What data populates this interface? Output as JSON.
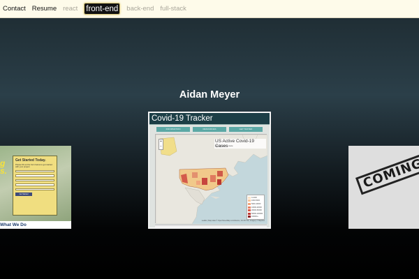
{
  "nav": {
    "items": [
      {
        "label": "Contact"
      },
      {
        "label": "Resume"
      },
      {
        "label": "react"
      },
      {
        "label": "front-end"
      },
      {
        "label": "back-end"
      },
      {
        "label": "full-stack"
      }
    ],
    "active": "front-end"
  },
  "hero": {
    "name": "Aidan Meyer"
  },
  "cards": {
    "center": {
      "title": "Covid-19 Tracker",
      "tabs": [
        "INFORMATION",
        "RESOURCES",
        "GET TESTED"
      ],
      "map_title": "US Active Covid-19 Cases",
      "map_subtitle": "Hover over a state",
      "legend": [
        "0-1000",
        "1000-5000",
        "5000-10000",
        "10000-20000",
        "20000-50000",
        "50000-100000",
        "100000+"
      ],
      "attribution": "Leaflet | Map data © OpenStreetMap contributors, CC-BY-SA, Imagery © Mapbox"
    },
    "left": {
      "hero_text": "g\ns.",
      "form_title": "Get Started Today.",
      "form_text": "Please fill out the form below to get started with your project.",
      "button": "Get Started",
      "section_title": "What We Do"
    },
    "right": {
      "stamp_text": "COMING"
    }
  },
  "colors": {
    "nav_bg": "#fefbea",
    "active_tab": "#111111",
    "tracker_header": "#1c3e46",
    "tracker_tab": "#5ba8a5"
  }
}
